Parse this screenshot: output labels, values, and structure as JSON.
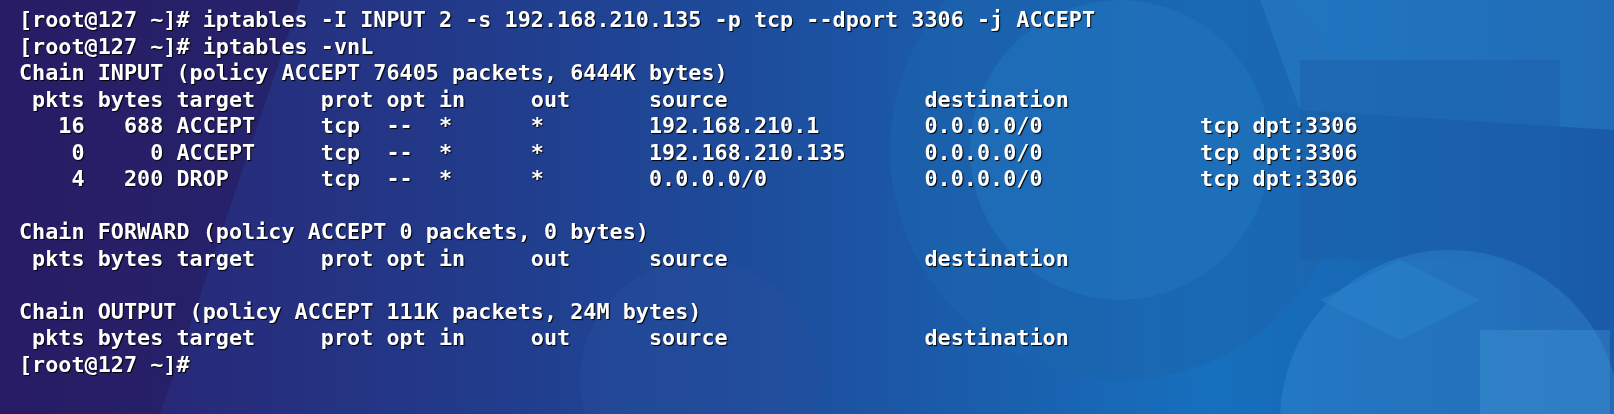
{
  "terminal": {
    "blocks": [
      [
        "[root@127 ~]# iptables -I INPUT 2 -s 192.168.210.135 -p tcp --dport 3306 -j ACCEPT",
        "[root@127 ~]# iptables -vnL",
        "Chain INPUT (policy ACCEPT 76405 packets, 6444K bytes)",
        " pkts bytes target     prot opt in     out      source               destination",
        "   16   688 ACCEPT     tcp  --  *      *        192.168.210.1        0.0.0.0/0            tcp dpt:3306",
        "    0     0 ACCEPT     tcp  --  *      *        192.168.210.135      0.0.0.0/0            tcp dpt:3306",
        "    4   200 DROP       tcp  --  *      *        0.0.0.0/0            0.0.0.0/0            tcp dpt:3306"
      ],
      [
        "Chain FORWARD (policy ACCEPT 0 packets, 0 bytes)",
        " pkts bytes target     prot opt in     out      source               destination"
      ],
      [
        "Chain OUTPUT (policy ACCEPT 111K packets, 24M bytes)",
        " pkts bytes target     prot opt in     out      source               destination",
        "[root@127 ~]#"
      ]
    ]
  }
}
